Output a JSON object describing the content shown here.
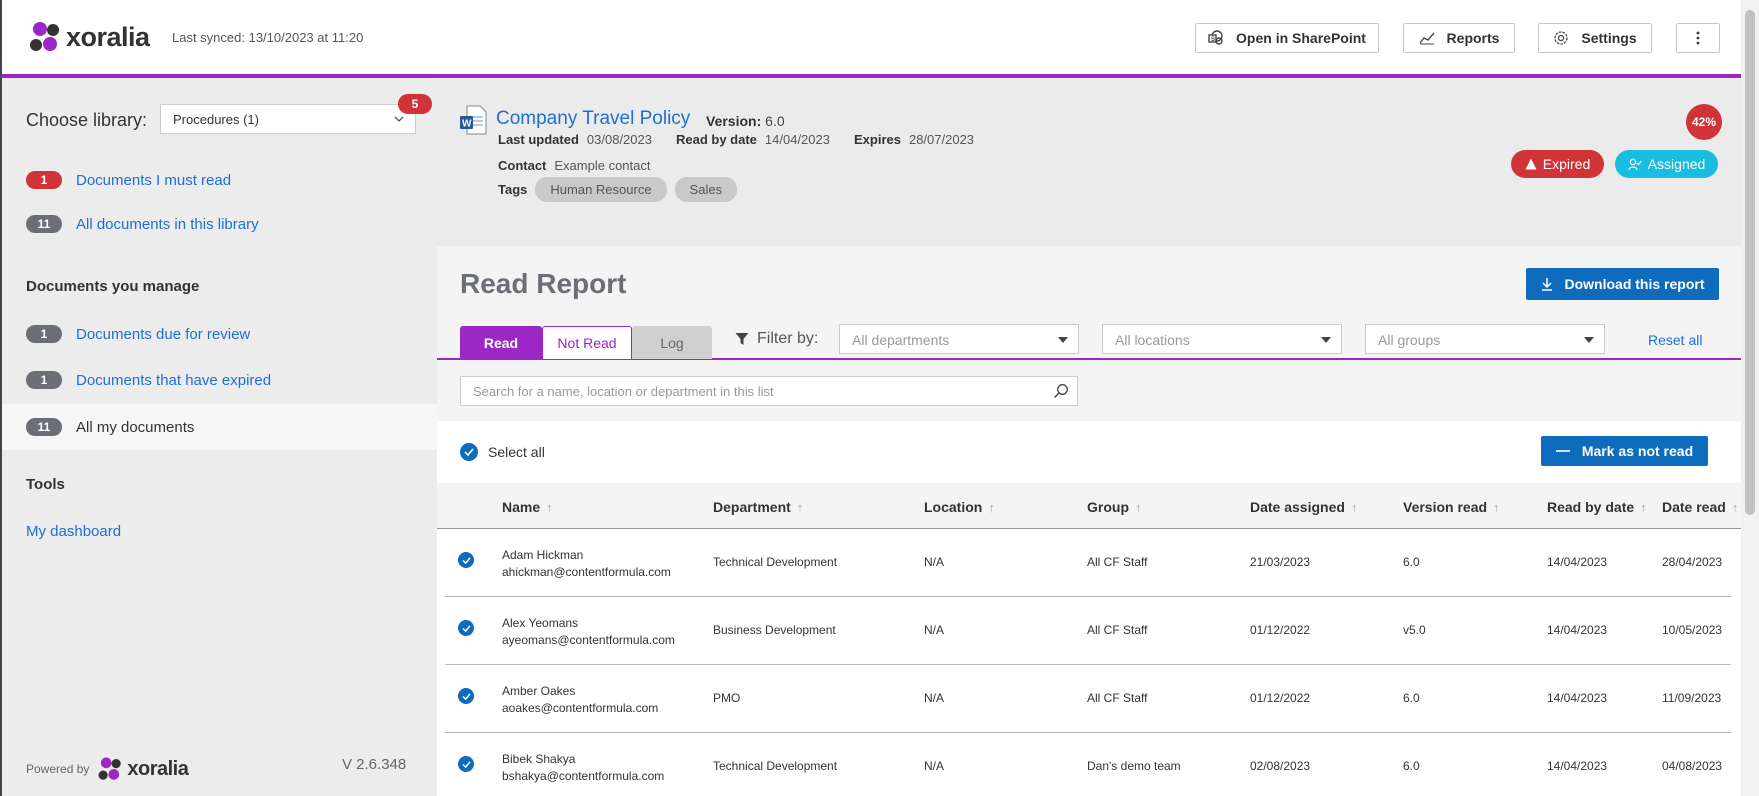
{
  "header": {
    "brand": "xoralia",
    "last_synced": "Last synced: 13/10/2023 at 11:20",
    "buttons": {
      "open_sharepoint": "Open in SharePoint",
      "reports": "Reports",
      "settings": "Settings"
    }
  },
  "sidebar": {
    "choose_library_label": "Choose library:",
    "library_selected": "Procedures (1)",
    "library_badge": "5",
    "items": [
      {
        "count": "1",
        "label": "Documents I must read"
      },
      {
        "count": "11",
        "label": "All documents in this library"
      }
    ],
    "manage_heading": "Documents you manage",
    "manage_items": [
      {
        "count": "1",
        "label": "Documents due for review"
      },
      {
        "count": "1",
        "label": "Documents that have expired"
      },
      {
        "count": "11",
        "label": "All my documents"
      }
    ],
    "tools_heading": "Tools",
    "dashboard_link": "My dashboard",
    "powered_by": "Powered by",
    "version": "V 2.6.348"
  },
  "document": {
    "title": "Company Travel Policy",
    "version_label": "Version:",
    "version": "6.0",
    "last_updated_label": "Last updated",
    "last_updated": "03/08/2023",
    "read_by_label": "Read by date",
    "read_by": "14/04/2023",
    "expires_label": "Expires",
    "expires": "28/07/2023",
    "contact_label": "Contact",
    "contact": "Example contact",
    "tags_label": "Tags",
    "tags": [
      "Human Resource",
      "Sales"
    ],
    "percent": "42%",
    "status_expired": "Expired",
    "status_assigned": "Assigned"
  },
  "report": {
    "title": "Read Report",
    "download_label": "Download this report",
    "tabs": {
      "read": "Read",
      "not_read": "Not Read",
      "log": "Log"
    },
    "filter_label": "Filter by:",
    "filters": {
      "departments": "All departments",
      "locations": "All locations",
      "groups": "All groups"
    },
    "reset_label": "Reset all",
    "search_placeholder": "Search for a name, location or department in this list",
    "select_all": "Select all",
    "mark_not_read": "Mark as not read",
    "columns": [
      "Name",
      "Department",
      "Location",
      "Group",
      "Date assigned",
      "Version read",
      "Read by date",
      "Date read"
    ],
    "rows": [
      {
        "name": "Adam Hickman",
        "email": "ahickman@contentformula.com",
        "department": "Technical Development",
        "location": "N/A",
        "group": "All CF Staff",
        "date_assigned": "21/03/2023",
        "version_read": "6.0",
        "read_by": "14/04/2023",
        "date_read": "28/04/2023"
      },
      {
        "name": "Alex Yeomans",
        "email": "ayeomans@contentformula.com",
        "department": "Business Development",
        "location": "N/A",
        "group": "All CF Staff",
        "date_assigned": "01/12/2022",
        "version_read": "v5.0",
        "read_by": "14/04/2023",
        "date_read": "10/05/2023"
      },
      {
        "name": "Amber Oakes",
        "email": "aoakes@contentformula.com",
        "department": "PMO",
        "location": "N/A",
        "group": "All CF Staff",
        "date_assigned": "01/12/2022",
        "version_read": "6.0",
        "read_by": "14/04/2023",
        "date_read": "11/09/2023"
      },
      {
        "name": "Bibek Shakya",
        "email": "bshakya@contentformula.com",
        "department": "Technical Development",
        "location": "N/A",
        "group": "Dan's demo team",
        "date_assigned": "02/08/2023",
        "version_read": "6.0",
        "read_by": "14/04/2023",
        "date_read": "04/08/2023"
      }
    ]
  }
}
